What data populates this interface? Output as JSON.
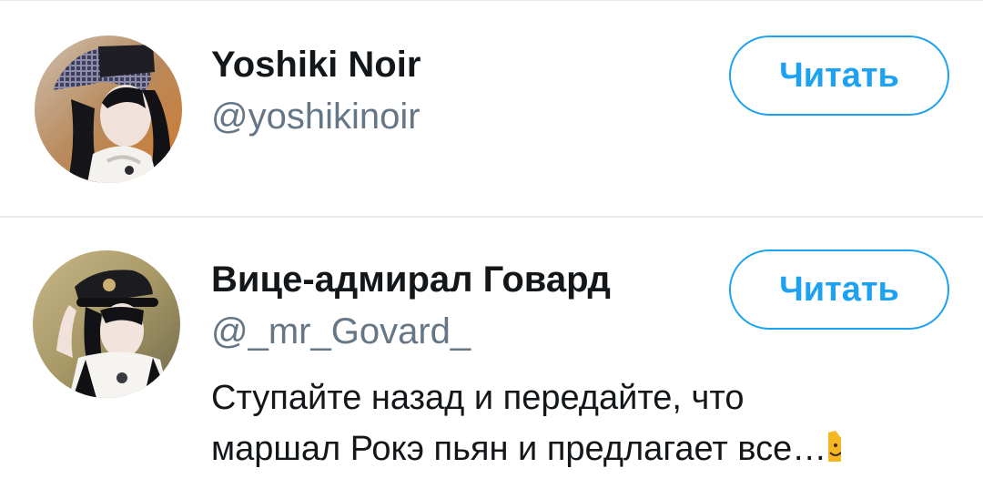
{
  "users": [
    {
      "name": "Yoshiki Noir",
      "handle": "@yoshikinoir",
      "follow_label": "Читать",
      "avatar_icon": "profile-photo"
    },
    {
      "name": "Вице-адмирал Говард",
      "handle": "@_mr_Govard_",
      "follow_label": "Читать",
      "avatar_icon": "profile-photo",
      "bio_lines": [
        "Ступайте назад и передайте, что",
        "маршал Рокэ пьян и предлагает все…"
      ],
      "bio_emoji": "cat-emoji"
    }
  ],
  "colors": {
    "accent": "#1da1f2",
    "name": "#14171a",
    "handle": "#657786",
    "divider": "#e6ecf0"
  }
}
